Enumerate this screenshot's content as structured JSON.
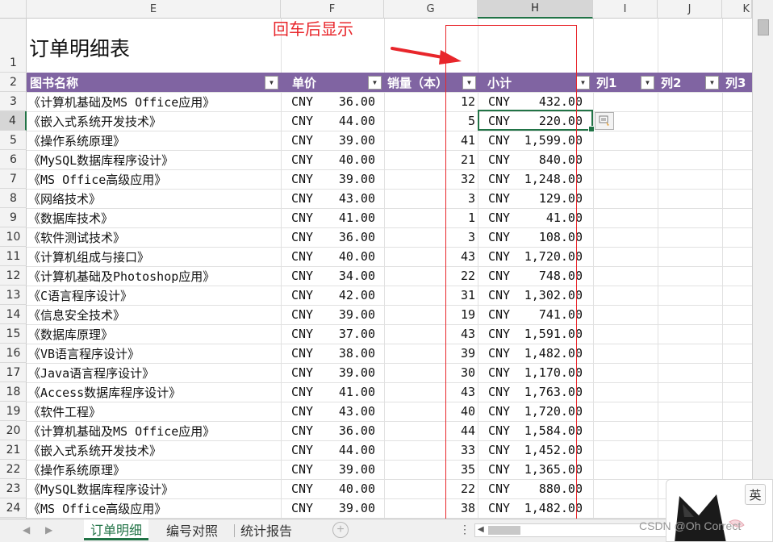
{
  "columns": [
    {
      "letter": "E",
      "selected": false
    },
    {
      "letter": "F",
      "selected": false
    },
    {
      "letter": "G",
      "selected": false
    },
    {
      "letter": "H",
      "selected": true
    },
    {
      "letter": "I",
      "selected": false
    },
    {
      "letter": "J",
      "selected": false
    },
    {
      "letter": "K",
      "selected": false
    }
  ],
  "rows": [
    "1",
    "2",
    "3",
    "4",
    "5",
    "6",
    "7",
    "8",
    "9",
    "10",
    "11",
    "12",
    "13",
    "14",
    "15",
    "16",
    "17",
    "18",
    "19",
    "20",
    "21",
    "22",
    "23",
    "24"
  ],
  "selected_row": "4",
  "sheet_title": "订单明细表",
  "table_headers": {
    "book_name": "图书名称",
    "unit_price": "单价",
    "quantity": "销量（本）",
    "subtotal": "小计",
    "col1": "列1",
    "col2": "列2",
    "col3": "列3"
  },
  "data_rows": [
    {
      "name": "《计算机基础及MS Office应用》",
      "currency": "CNY",
      "price": "36.00",
      "qty": "12",
      "sub_currency": "CNY",
      "subtotal": "432.00"
    },
    {
      "name": "《嵌入式系统开发技术》",
      "currency": "CNY",
      "price": "44.00",
      "qty": "5",
      "sub_currency": "CNY",
      "subtotal": "220.00"
    },
    {
      "name": "《操作系统原理》",
      "currency": "CNY",
      "price": "39.00",
      "qty": "41",
      "sub_currency": "CNY",
      "subtotal": "1,599.00"
    },
    {
      "name": "《MySQL数据库程序设计》",
      "currency": "CNY",
      "price": "40.00",
      "qty": "21",
      "sub_currency": "CNY",
      "subtotal": "840.00"
    },
    {
      "name": "《MS Office高级应用》",
      "currency": "CNY",
      "price": "39.00",
      "qty": "32",
      "sub_currency": "CNY",
      "subtotal": "1,248.00"
    },
    {
      "name": "《网络技术》",
      "currency": "CNY",
      "price": "43.00",
      "qty": "3",
      "sub_currency": "CNY",
      "subtotal": "129.00"
    },
    {
      "name": "《数据库技术》",
      "currency": "CNY",
      "price": "41.00",
      "qty": "1",
      "sub_currency": "CNY",
      "subtotal": "41.00"
    },
    {
      "name": "《软件测试技术》",
      "currency": "CNY",
      "price": "36.00",
      "qty": "3",
      "sub_currency": "CNY",
      "subtotal": "108.00"
    },
    {
      "name": "《计算机组成与接口》",
      "currency": "CNY",
      "price": "40.00",
      "qty": "43",
      "sub_currency": "CNY",
      "subtotal": "1,720.00"
    },
    {
      "name": "《计算机基础及Photoshop应用》",
      "currency": "CNY",
      "price": "34.00",
      "qty": "22",
      "sub_currency": "CNY",
      "subtotal": "748.00"
    },
    {
      "name": "《C语言程序设计》",
      "currency": "CNY",
      "price": "42.00",
      "qty": "31",
      "sub_currency": "CNY",
      "subtotal": "1,302.00"
    },
    {
      "name": "《信息安全技术》",
      "currency": "CNY",
      "price": "39.00",
      "qty": "19",
      "sub_currency": "CNY",
      "subtotal": "741.00"
    },
    {
      "name": "《数据库原理》",
      "currency": "CNY",
      "price": "37.00",
      "qty": "43",
      "sub_currency": "CNY",
      "subtotal": "1,591.00"
    },
    {
      "name": "《VB语言程序设计》",
      "currency": "CNY",
      "price": "38.00",
      "qty": "39",
      "sub_currency": "CNY",
      "subtotal": "1,482.00"
    },
    {
      "name": "《Java语言程序设计》",
      "currency": "CNY",
      "price": "39.00",
      "qty": "30",
      "sub_currency": "CNY",
      "subtotal": "1,170.00"
    },
    {
      "name": "《Access数据库程序设计》",
      "currency": "CNY",
      "price": "41.00",
      "qty": "43",
      "sub_currency": "CNY",
      "subtotal": "1,763.00"
    },
    {
      "name": "《软件工程》",
      "currency": "CNY",
      "price": "43.00",
      "qty": "40",
      "sub_currency": "CNY",
      "subtotal": "1,720.00"
    },
    {
      "name": "《计算机基础及MS Office应用》",
      "currency": "CNY",
      "price": "36.00",
      "qty": "44",
      "sub_currency": "CNY",
      "subtotal": "1,584.00"
    },
    {
      "name": "《嵌入式系统开发技术》",
      "currency": "CNY",
      "price": "44.00",
      "qty": "33",
      "sub_currency": "CNY",
      "subtotal": "1,452.00"
    },
    {
      "name": "《操作系统原理》",
      "currency": "CNY",
      "price": "39.00",
      "qty": "35",
      "sub_currency": "CNY",
      "subtotal": "1,365.00"
    },
    {
      "name": "《MySQL数据库程序设计》",
      "currency": "CNY",
      "price": "40.00",
      "qty": "22",
      "sub_currency": "CNY",
      "subtotal": "880.00"
    },
    {
      "name": "《MS Office高级应用》",
      "currency": "CNY",
      "price": "39.00",
      "qty": "38",
      "sub_currency": "CNY",
      "subtotal": "1,482.00"
    }
  ],
  "annotation": {
    "text": "回车后显示",
    "color": "#e8262b"
  },
  "sheet_tabs": [
    {
      "label": "订单明细",
      "active": true
    },
    {
      "label": "编号对照",
      "active": false
    },
    {
      "label": "统计报告",
      "active": false
    }
  ],
  "add_sheet_symbol": "+",
  "tab_menu_symbol": "⋮",
  "watermark": "CSDN @Oh Correct",
  "ime_indicator": "英",
  "colors": {
    "table_header_bg": "#8064a2",
    "selection": "#217346",
    "annotation": "#e8262b"
  },
  "icons": {
    "filter": "filter-dropdown-icon",
    "autofill": "autofill-options-icon",
    "pet": "cat-ear-icon"
  }
}
